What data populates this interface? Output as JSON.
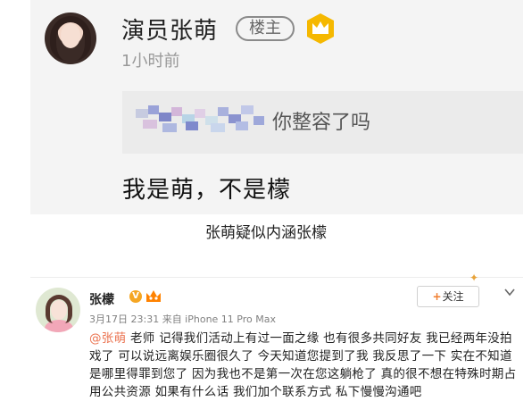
{
  "top_post": {
    "user_name": "演员张萌",
    "owner_tag": "楼主",
    "time": "1小时前",
    "quoted_text": "你整容了吗",
    "reply_text": "我是萌，不是檬"
  },
  "caption": "张萌疑似内涵张檬",
  "weibo_post": {
    "user_name": "张檬",
    "follow_label": "关注",
    "meta": "3月17日 23:31 来自 iPhone 11 Pro Max",
    "mention": "@张萌",
    "body": " 老师  记得我们活动上有过一面之缘  也有很多共同好友  我已经两年没拍戏了  可以说远离娱乐圈很久了  今天知道您提到了我  我反思了一下  实在不知道是哪里得罪到您了  因为我也不是第一次在您这躺枪了   真的很不想在特殊时期占用公共资源  如果有什么话  我们加个联系方式 私下慢慢沟通吧"
  },
  "colors": {
    "accent_orange": "#f07c2c",
    "mention": "#eb7350",
    "crown_gold": "#f5b800",
    "panel_gray": "#f4f4f4"
  },
  "icons": [
    "crown-badge-icon",
    "vip-v-icon",
    "member-crown-icon",
    "plus-icon",
    "chevron-down-icon",
    "sparkle-icon"
  ]
}
